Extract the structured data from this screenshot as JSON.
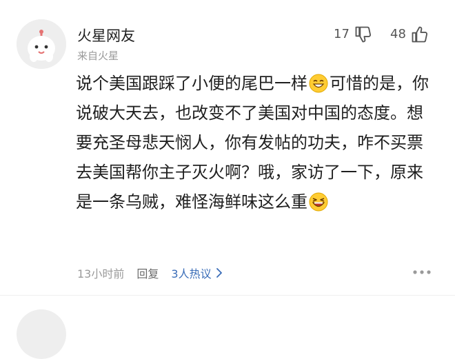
{
  "comment": {
    "username": "火星网友",
    "source": "来自火星",
    "downvotes": "17",
    "upvotes": "48",
    "text_lines": [
      "说个美国跟踩了小便的尾巴一样",
      "可惜的是，你说破大天去，也改变不了美国对中",
      "国的态度。想要充圣母悲天悯人，你有发",
      "帖的功夫，咋不买票去美国帮你主子灭火",
      "啊？哦，家访了一下，原来是一条乌贼，",
      "难怪海鲜味这么重"
    ],
    "time": "13小时前",
    "reply_label": "回复",
    "replies_link": "3人热议",
    "icons": {
      "avatar": "mars-mascot-avatar",
      "downvote": "thumbs-down-icon",
      "upvote": "thumbs-up-icon",
      "emoji_1": "grin-emoji-icon",
      "emoji_2": "laughing-emoji-icon",
      "replies": "chevron-right-icon",
      "more": "more-dots-icon"
    },
    "colors": {
      "link": "#3a6db8",
      "muted": "#9a9a9a",
      "text": "#1f1f1f"
    }
  }
}
